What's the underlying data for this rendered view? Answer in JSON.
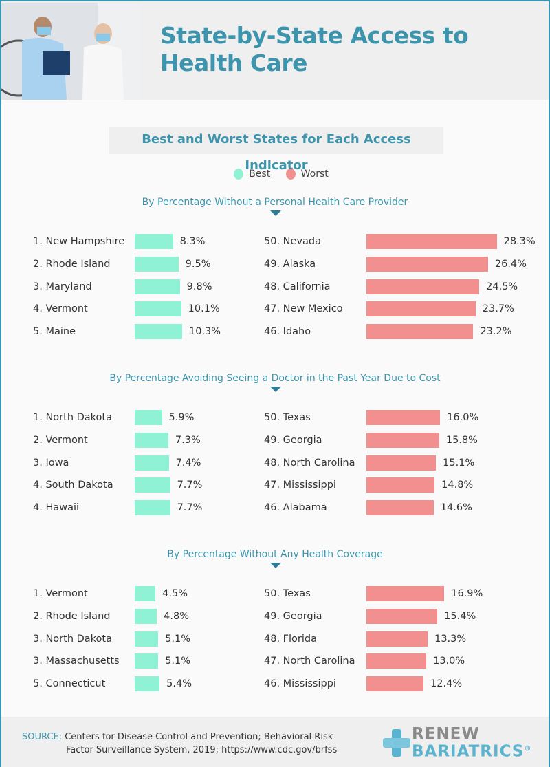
{
  "header": {
    "title_line1": "State-by-State Access to",
    "title_line2": "Health Care"
  },
  "subtitle": "Best and Worst States for Each Access Indicator",
  "legend": {
    "best": "Best",
    "worst": "Worst"
  },
  "colors": {
    "best": "#8ff2d4",
    "worst": "#f28f8f",
    "accent": "#3d95ad"
  },
  "chart_data": [
    {
      "type": "bar",
      "title": "By Percentage Without a Personal Health Care Provider",
      "best": [
        {
          "rank": "1.",
          "state": "New Hampshire",
          "value": 8.3
        },
        {
          "rank": "2.",
          "state": "Rhode Island",
          "value": 9.5
        },
        {
          "rank": "3.",
          "state": "Maryland",
          "value": 9.8
        },
        {
          "rank": "4.",
          "state": "Vermont",
          "value": 10.1
        },
        {
          "rank": "5.",
          "state": "Maine",
          "value": 10.3
        }
      ],
      "worst": [
        {
          "rank": "50.",
          "state": "Nevada",
          "value": 28.3
        },
        {
          "rank": "49.",
          "state": "Alaska",
          "value": 26.4
        },
        {
          "rank": "48.",
          "state": "California",
          "value": 24.5
        },
        {
          "rank": "47.",
          "state": "New Mexico",
          "value": 23.7
        },
        {
          "rank": "46.",
          "state": "Idaho",
          "value": 23.2
        }
      ]
    },
    {
      "type": "bar",
      "title": "By Percentage Avoiding Seeing a Doctor in the Past Year Due to Cost",
      "best": [
        {
          "rank": "1.",
          "state": "North Dakota",
          "value": 5.9
        },
        {
          "rank": "2.",
          "state": "Vermont",
          "value": 7.3
        },
        {
          "rank": "3.",
          "state": "Iowa",
          "value": 7.4
        },
        {
          "rank": "4.",
          "state": "South Dakota",
          "value": 7.7
        },
        {
          "rank": "4.",
          "state": "Hawaii",
          "value": 7.7
        }
      ],
      "worst": [
        {
          "rank": "50.",
          "state": "Texas",
          "value": 16.0
        },
        {
          "rank": "49.",
          "state": "Georgia",
          "value": 15.8
        },
        {
          "rank": "48.",
          "state": "North Carolina",
          "value": 15.1
        },
        {
          "rank": "47.",
          "state": "Mississippi",
          "value": 14.8
        },
        {
          "rank": "46.",
          "state": "Alabama",
          "value": 14.6
        }
      ]
    },
    {
      "type": "bar",
      "title": "By Percentage Without Any Health Coverage",
      "best": [
        {
          "rank": "1.",
          "state": "Vermont",
          "value": 4.5
        },
        {
          "rank": "2.",
          "state": "Rhode Island",
          "value": 4.8
        },
        {
          "rank": "3.",
          "state": "North Dakota",
          "value": 5.1
        },
        {
          "rank": "3.",
          "state": "Massachusetts",
          "value": 5.1
        },
        {
          "rank": "5.",
          "state": "Connecticut",
          "value": 5.4
        }
      ],
      "worst": [
        {
          "rank": "50.",
          "state": "Texas",
          "value": 16.9
        },
        {
          "rank": "49.",
          "state": "Georgia",
          "value": 15.4
        },
        {
          "rank": "48.",
          "state": "Florida",
          "value": 13.3
        },
        {
          "rank": "47.",
          "state": "North Carolina",
          "value": 13.0
        },
        {
          "rank": "46.",
          "state": "Mississippi",
          "value": 12.4
        }
      ]
    }
  ],
  "footer": {
    "source_label": "SOURCE:",
    "source_line1": "Centers for Disease Control and Prevention; Behavioral Risk",
    "source_line2": "Factor Surveillance System, 2019; https://www.cdc.gov/brfss",
    "logo_line1": "RENEW",
    "logo_line2": "BARIATRICS",
    "logo_mark": "®"
  }
}
